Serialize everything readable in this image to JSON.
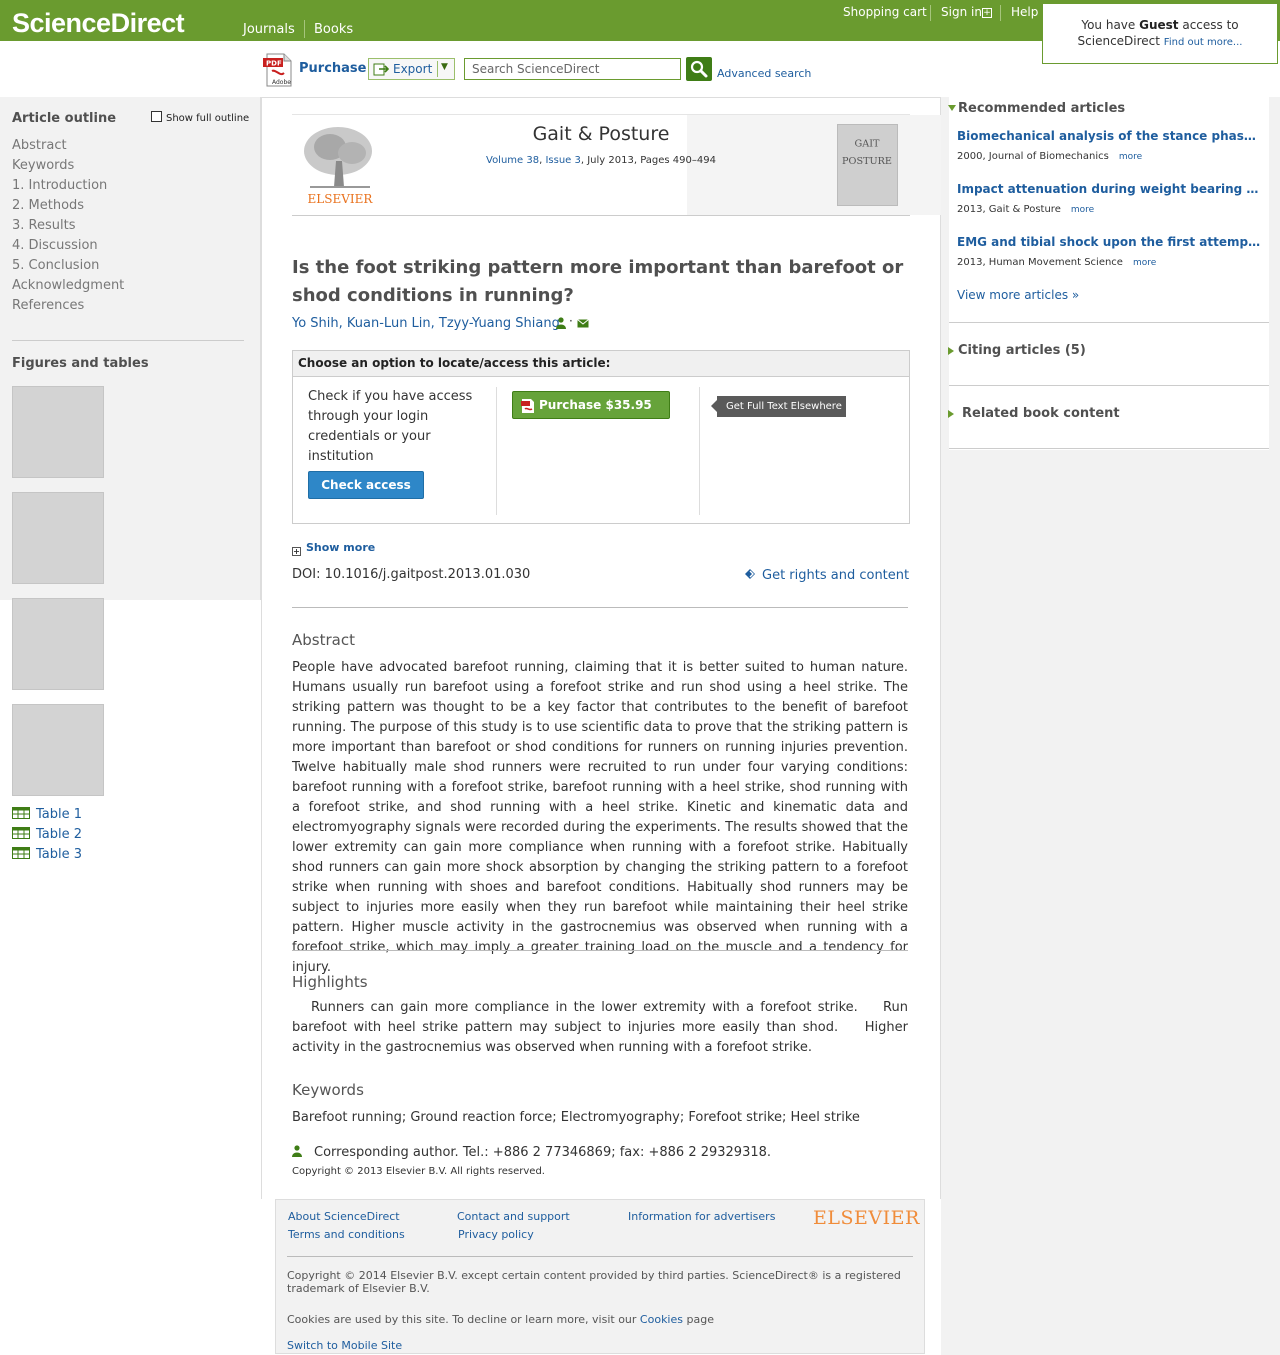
{
  "topbar": {
    "logo": "ScienceDirect",
    "nav": [
      "Journals",
      "Books"
    ],
    "shopping_cart": "Shopping cart",
    "sign_in": "Sign in",
    "help": "Help"
  },
  "guest_box": {
    "line1_prefix": "You have ",
    "line1_bold": "Guest",
    "line1_suffix": " access to",
    "line2": "ScienceDirect ",
    "find_out": "Find out more..."
  },
  "toolbar": {
    "purchase": "Purchase",
    "export": "Export",
    "search_placeholder": "Search ScienceDirect",
    "advanced_search": "Advanced search"
  },
  "outline": {
    "title": "Article outline",
    "show_full": "Show full outline",
    "items": [
      "Abstract",
      "Keywords",
      "1. Introduction",
      "2. Methods",
      "3. Results",
      "4. Discussion",
      "5. Conclusion",
      "Acknowledgment",
      "References"
    ]
  },
  "figures": {
    "title": "Figures and tables",
    "tables": [
      "Table 1",
      "Table 2",
      "Table 3"
    ]
  },
  "journal": {
    "title": "Gait & Posture",
    "volume": "Volume 38",
    "issue": "Issue 3",
    "date_pages": ", July 2013, Pages 490–494",
    "publisher_logo": "ELSEVIER",
    "cover_text": "GAIT POSTURE"
  },
  "article": {
    "title": "Is the foot striking pattern more important than barefoot or shod conditions in running?",
    "authors": [
      "Yo Shih",
      "Kuan-Lun Lin",
      "Tzyy-Yuang Shiang"
    ],
    "doi": "DOI:  10.1016/j.gaitpost.2013.01.030",
    "rights": "Get rights and content",
    "show_more": "Show more"
  },
  "access": {
    "heading": "Choose an option to locate/access this article:",
    "text": "Check if you have access through your login credentials or your institution",
    "check_button": "Check access",
    "purchase_button": "Purchase $35.95",
    "fulltext_button": "Get Full Text Elsewhere"
  },
  "abstract": {
    "title": "Abstract",
    "text": "People have advocated barefoot running, claiming that it is better suited to human nature. Humans usually run barefoot using a forefoot strike and run shod using a heel strike. The striking pattern was thought to be a key factor that contributes to the benefit of barefoot running. The purpose of this study is to use scientific data to prove that the striking pattern is more important than barefoot or shod conditions for runners on running injuries prevention. Twelve habitually male shod runners were recruited to run under four varying conditions: barefoot running with a forefoot strike, barefoot running with a heel strike, shod running with a forefoot strike, and shod running with a heel strike. Kinetic and kinematic data and electromyography signals were recorded during the experiments. The results showed that the lower extremity can gain more compliance when running with a forefoot strike. Habitually shod runners can gain more shock absorption by changing the striking pattern to a forefoot strike when running with shoes and barefoot conditions. Habitually shod runners may be subject to injuries more easily when they run barefoot while maintaining their heel strike pattern. Higher muscle activity in the gastrocnemius was observed when running with a forefoot strike, which may imply a greater training load on the muscle and a tendency for injury."
  },
  "highlights": {
    "title": "Highlights",
    "text": "   Runners can gain more compliance in the lower extremity with a forefoot strike.    Run barefoot with heel strike pattern may subject to injuries more easily than shod.    Higher activity in the gastrocnemius was observed when running with a forefoot strike."
  },
  "keywords": {
    "title": "Keywords",
    "text": "Barefoot running; Ground reaction force; Electromyography; Forefoot strike; Heel strike"
  },
  "corresponding": "Corresponding author. Tel.: +886 2 77346869; fax: +886 2 29329318.",
  "copyright": "Copyright © 2013 Elsevier B.V. All rights reserved.",
  "footer": {
    "about": "About ScienceDirect",
    "terms": "Terms and conditions",
    "contact": "Contact and support",
    "privacy": "Privacy policy",
    "advertisers": "Information for advertisers",
    "elsevier": "ELSEVIER",
    "copyright": "Copyright © 2014 Elsevier B.V. except certain content provided by third parties. ScienceDirect® is a registered trademark of Elsevier B.V.",
    "cookies_prefix": "Cookies are used by this site. To decline or learn more, visit our ",
    "cookies_link": "Cookies",
    "cookies_suffix": " page",
    "switch_mobile": "Switch to Mobile Site"
  },
  "right_panel": {
    "recommended_title": "Recommended articles",
    "recommended": [
      {
        "title": "Biomechanical analysis of the stance phase during barefoot and shod running",
        "meta": "2000, Journal of Biomechanics",
        "more": "more"
      },
      {
        "title": "Impact attenuation during weight bearing activities in barefoot vs. shod conditions",
        "meta": "2013, Gait & Posture",
        "more": "more"
      },
      {
        "title": "EMG and tibial shock upon the first attempt at barefoot running",
        "meta": "2013, Human Movement Science",
        "more": "more"
      }
    ],
    "view_more": "View more articles »",
    "citing": "Citing articles (5)",
    "related": "Related book content"
  },
  "colors": {
    "brand_green": "#6a9b2f",
    "link_blue": "#1e5d9e",
    "purchase_green": "#66a33a",
    "check_blue": "#2e87c8",
    "elsevier_orange": "#f08c3a"
  }
}
